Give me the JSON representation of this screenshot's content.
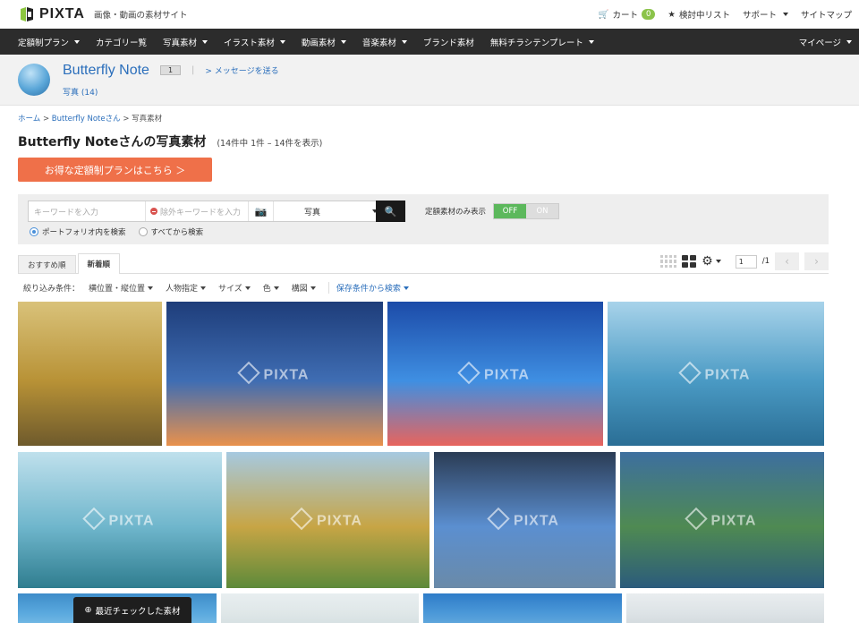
{
  "header": {
    "logo_text": "PIXTA",
    "tagline": "画像・動画の素材サイト",
    "cart_label": "カート",
    "cart_count": "0",
    "watchlist_label": "検討中リスト",
    "support_label": "サポート",
    "sitemap_label": "サイトマップ"
  },
  "nav": {
    "items": [
      {
        "label": "定額制プラン",
        "dropdown": true
      },
      {
        "label": "カテゴリー覧",
        "dropdown": false
      },
      {
        "label": "写真素材",
        "dropdown": true
      },
      {
        "label": "イラスト素材",
        "dropdown": true
      },
      {
        "label": "動画素材",
        "dropdown": true
      },
      {
        "label": "音楽素材",
        "dropdown": true
      },
      {
        "label": "ブランド素材",
        "dropdown": false
      },
      {
        "label": "無料チラシテンプレート",
        "dropdown": true
      }
    ],
    "mypage_label": "マイページ"
  },
  "creator": {
    "name": "Butterfly Note",
    "level": "1",
    "separator": "|",
    "message_link": "> メッセージを送る",
    "photos_label": "写真 (14)"
  },
  "breadcrumb": {
    "home": "ホーム",
    "creator": "Butterfly Noteさん",
    "current": "写真素材",
    "sep": ">"
  },
  "page": {
    "title": "Butterfly Noteさんの写真素材",
    "count_text": "(14件中 1件 – 14件を表示)",
    "plan_button": "お得な定額制プランはこちら ＞"
  },
  "search": {
    "keyword_placeholder": "キーワードを入力",
    "exclude_placeholder": "除外キーワードを入力",
    "camera_icon": "📷",
    "category_value": "写真",
    "search_icon": "🔍",
    "fixed_label": "定額素材のみ表示",
    "toggle_on": "OFF",
    "toggle_off": "ON",
    "radio_portfolio": "ポートフォリオ内を検索",
    "radio_all": "すべてから検索"
  },
  "tabs": {
    "recommended": "おすすめ順",
    "newest": "新着順"
  },
  "pager": {
    "current_page": "1",
    "total": "/1",
    "prev": "‹",
    "next": "›",
    "gear": "⚙"
  },
  "filters": {
    "label": "絞り込み条件：",
    "items": [
      "横位置・縦位置",
      "人物指定",
      "サイズ",
      "色",
      "構図"
    ],
    "saved": "保存条件から検索"
  },
  "images": {
    "watermark": "PIXTA",
    "items": [
      {
        "alt": "food-ajillo",
        "colors": [
          "#d9c27a",
          "#b89236",
          "#6e5a2c"
        ]
      },
      {
        "alt": "sunset-skyline-1",
        "colors": [
          "#1e3d7a",
          "#3f6db3",
          "#e9914c"
        ]
      },
      {
        "alt": "sunset-skyline-2",
        "colors": [
          "#1c4ba8",
          "#3f8fe2",
          "#e8645d"
        ]
      },
      {
        "alt": "sea-blue",
        "colors": [
          "#a8d3ea",
          "#4a9ac4",
          "#2a6e95"
        ]
      },
      {
        "alt": "sea-shore",
        "colors": [
          "#bfe0ec",
          "#6fb6cc",
          "#2f7d8f"
        ]
      },
      {
        "alt": "autumn-park",
        "colors": [
          "#a6c9e0",
          "#c7a545",
          "#5d8a3a"
        ]
      },
      {
        "alt": "bridge-river",
        "colors": [
          "#2b3c55",
          "#5b8fd0",
          "#6a8aa8"
        ]
      },
      {
        "alt": "bridge-pond",
        "colors": [
          "#3d6f9f",
          "#4f8a52",
          "#2b5b7c"
        ]
      },
      {
        "alt": "row3-1",
        "colors": [
          "#3e8cc9",
          "#5aa9de",
          "#7ebfe7"
        ]
      },
      {
        "alt": "row3-2",
        "colors": [
          "#e8eef0",
          "#dfe7e8",
          "#d3dde0"
        ]
      },
      {
        "alt": "row3-3",
        "colors": [
          "#2e7cc8",
          "#4b98d8",
          "#6aaede"
        ]
      },
      {
        "alt": "row3-4",
        "colors": [
          "#e9edef",
          "#dde3e6",
          "#cfd7db"
        ]
      }
    ]
  },
  "recent_button": "最近チェックした素材"
}
